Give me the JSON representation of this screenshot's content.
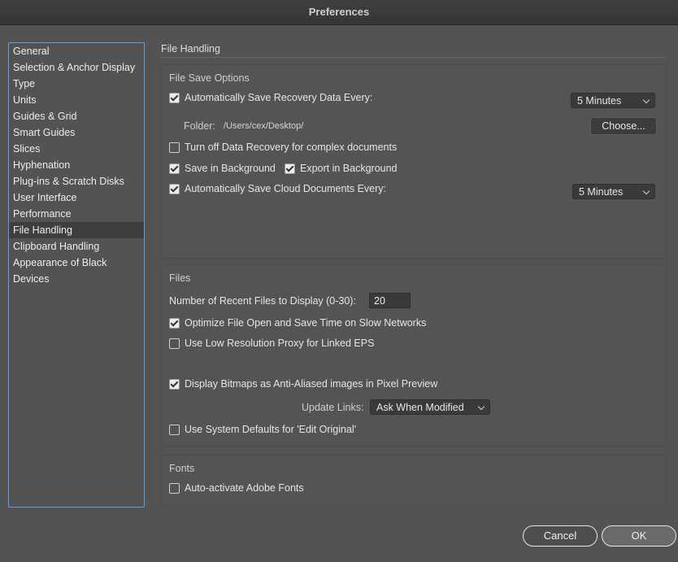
{
  "window": {
    "title": "Preferences"
  },
  "sidebar": {
    "items": [
      {
        "label": "General"
      },
      {
        "label": "Selection & Anchor Display"
      },
      {
        "label": "Type"
      },
      {
        "label": "Units"
      },
      {
        "label": "Guides & Grid"
      },
      {
        "label": "Smart Guides"
      },
      {
        "label": "Slices"
      },
      {
        "label": "Hyphenation"
      },
      {
        "label": "Plug-ins & Scratch Disks"
      },
      {
        "label": "User Interface"
      },
      {
        "label": "Performance"
      },
      {
        "label": "File Handling"
      },
      {
        "label": "Clipboard Handling"
      },
      {
        "label": "Appearance of Black"
      },
      {
        "label": "Devices"
      }
    ],
    "selected": "File Handling"
  },
  "main": {
    "title": "File Handling",
    "file_save": {
      "title": "File Save Options",
      "auto_save": {
        "label": "Automatically Save Recovery Data Every:",
        "checked": true,
        "interval": "5 Minutes"
      },
      "folder": {
        "label": "Folder:",
        "path": "/Users/cex/Desktop/",
        "choose": "Choose..."
      },
      "turn_off_recovery": {
        "label": "Turn off Data Recovery for complex documents",
        "checked": false
      },
      "save_background": {
        "label": "Save in Background",
        "checked": true
      },
      "export_background": {
        "label": "Export in Background",
        "checked": true
      },
      "auto_save_cloud": {
        "label": "Automatically Save Cloud Documents Every:",
        "checked": true,
        "interval": "5 Minutes"
      }
    },
    "files": {
      "title": "Files",
      "recent_label": "Number of Recent Files to Display (0-30):",
      "recent_value": "20",
      "optimize": {
        "label": "Optimize File Open and Save Time on Slow Networks",
        "checked": true
      },
      "low_res": {
        "label": "Use Low Resolution Proxy for Linked EPS",
        "checked": false
      },
      "anti_alias": {
        "label": "Display Bitmaps as Anti-Aliased images in Pixel Preview",
        "checked": true
      },
      "update_links": {
        "label": "Update Links:",
        "value": "Ask When Modified"
      },
      "system_defaults": {
        "label": "Use System Defaults for 'Edit Original'",
        "checked": false
      }
    },
    "fonts": {
      "title": "Fonts",
      "auto_activate": {
        "label": "Auto-activate Adobe Fonts",
        "checked": false
      }
    }
  },
  "footer": {
    "cancel": "Cancel",
    "ok": "OK"
  }
}
